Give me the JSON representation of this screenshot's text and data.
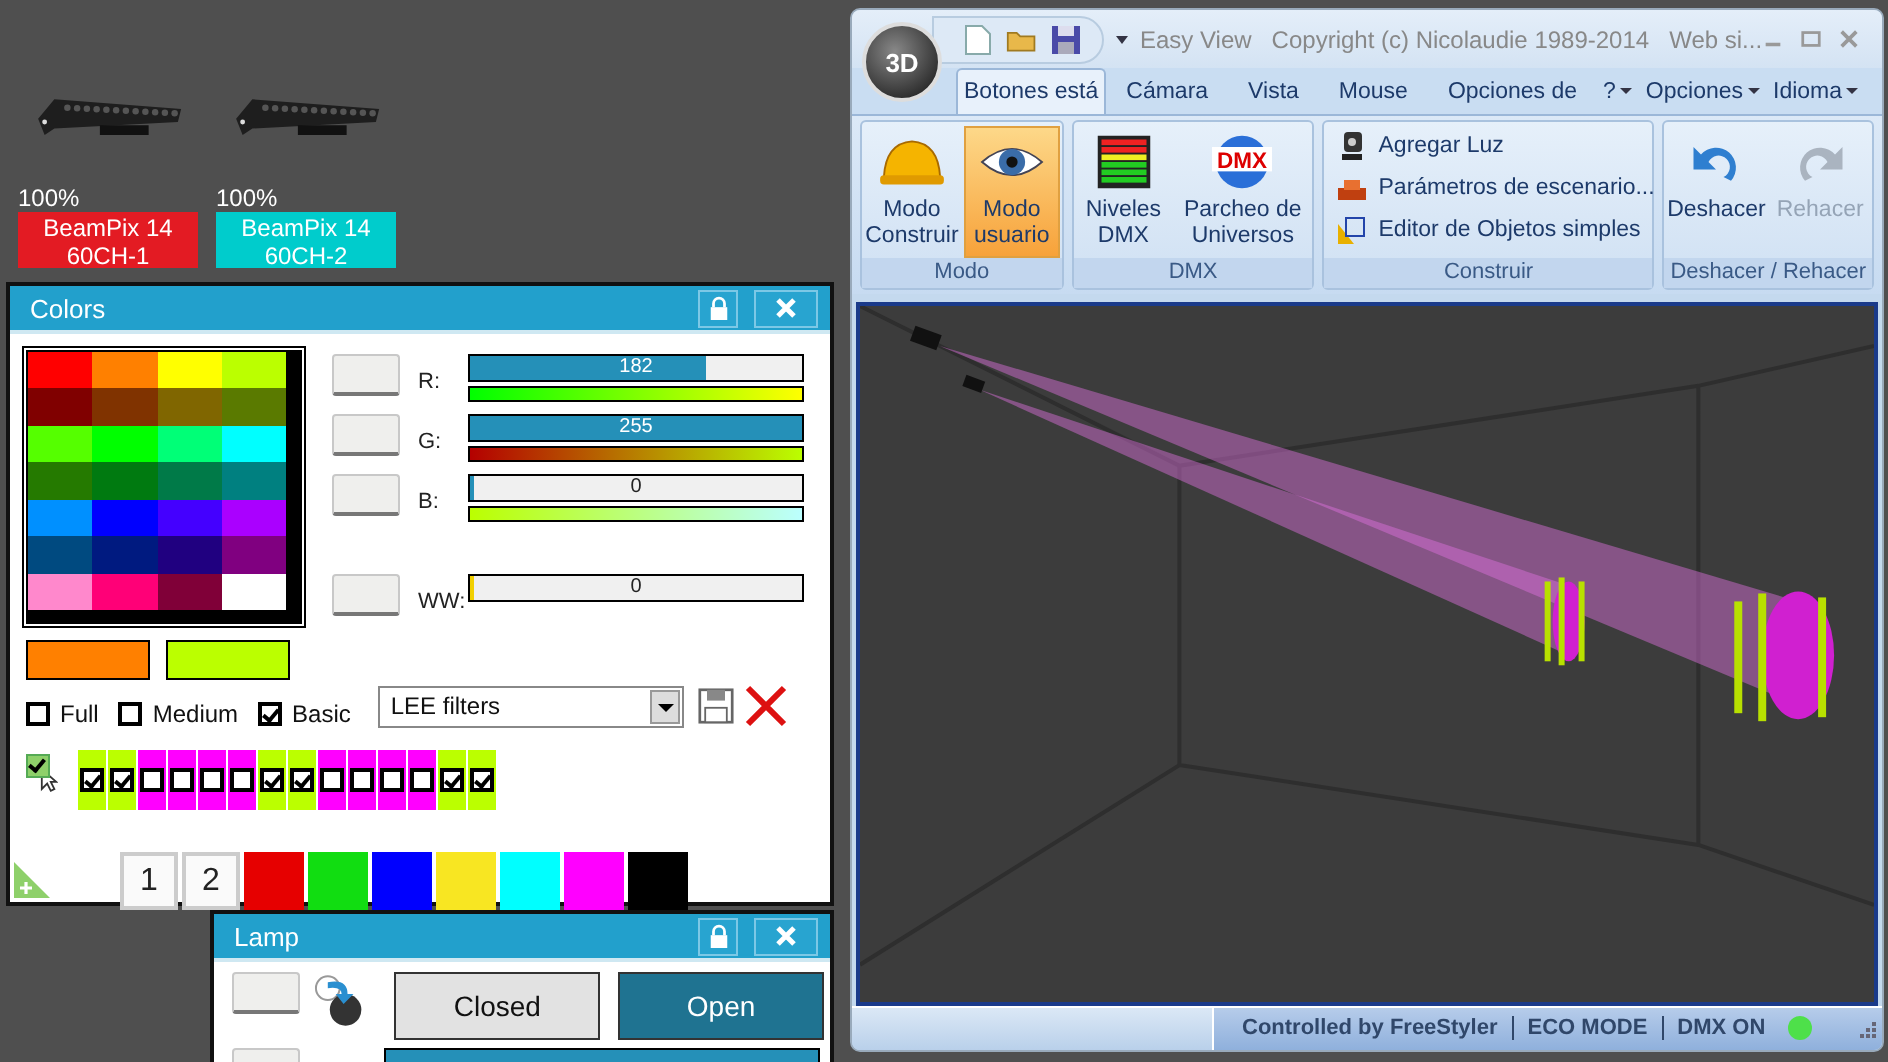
{
  "fixtures": [
    {
      "intensity": "100%",
      "name": "BeamPix 14 60CH-1",
      "color": "#e31b23"
    },
    {
      "intensity": "100%",
      "name": "BeamPix 14 60CH-2",
      "color": "#00cccc"
    }
  ],
  "colors_panel": {
    "title": "Colors",
    "palette": [
      {
        "color": "#ff0000"
      },
      {
        "color": "#ff8000"
      },
      {
        "color": "#ffff00"
      },
      {
        "color": "#bbff00"
      },
      {
        "color": "#800000"
      },
      {
        "color": "#803300"
      },
      {
        "color": "#806600"
      },
      {
        "color": "#5a7a00"
      },
      {
        "color": "#55ff00"
      },
      {
        "color": "#00ff00"
      },
      {
        "color": "#00ff77"
      },
      {
        "color": "#00ffff"
      },
      {
        "color": "#257a00"
      },
      {
        "color": "#007a10"
      },
      {
        "color": "#007a48"
      },
      {
        "color": "#008080"
      },
      {
        "color": "#0090ff"
      },
      {
        "color": "#0000ff"
      },
      {
        "color": "#4400ff"
      },
      {
        "color": "#aa00ff"
      },
      {
        "color": "#004a80"
      },
      {
        "color": "#001a80"
      },
      {
        "color": "#200080"
      },
      {
        "color": "#800080"
      },
      {
        "color": "#ff88cc"
      },
      {
        "color": "#ff0077"
      },
      {
        "color": "#800038"
      },
      {
        "color": "#ffffff"
      }
    ],
    "channels": [
      {
        "label": "R:",
        "reading": "182",
        "level": 0.71,
        "kind": "color"
      },
      {
        "label": "G:",
        "reading": "255",
        "level": 1,
        "kind": "color"
      },
      {
        "label": "B:",
        "reading": "0",
        "level": 0,
        "kind": "color"
      },
      {
        "label": "WW:",
        "reading": "0",
        "level": 0,
        "kind": "white"
      }
    ],
    "current_colors": [
      {
        "color": "#ff8000"
      },
      {
        "color": "#bbff00"
      }
    ],
    "modes": [
      {
        "label": "Full",
        "checked": false
      },
      {
        "label": "Medium",
        "checked": false
      },
      {
        "label": "Basic",
        "checked": true
      }
    ],
    "filter": {
      "value": "LEE filters"
    },
    "select_all": {
      "checked": true
    },
    "pixels": [
      {
        "checked": true
      },
      {
        "checked": true
      },
      {
        "checked": false
      },
      {
        "checked": false
      },
      {
        "checked": false
      },
      {
        "checked": false
      },
      {
        "checked": true
      },
      {
        "checked": true
      },
      {
        "checked": false
      },
      {
        "checked": false
      },
      {
        "checked": false
      },
      {
        "checked": false
      },
      {
        "checked": true
      },
      {
        "checked": true
      }
    ],
    "presets": [
      {
        "kind": "number",
        "label": "1"
      },
      {
        "kind": "number",
        "label": "2"
      },
      {
        "kind": "color",
        "color": "#e60000"
      },
      {
        "kind": "color",
        "color": "#11dd11"
      },
      {
        "kind": "color",
        "color": "#0000ff"
      },
      {
        "kind": "color",
        "color": "#f8e622"
      },
      {
        "kind": "color",
        "color": "#00ffff"
      },
      {
        "kind": "color",
        "color": "#ff00ff"
      },
      {
        "kind": "color",
        "color": "#000000"
      }
    ]
  },
  "lamp_panel": {
    "title": "Lamp",
    "buttons": [
      {
        "label": "Closed",
        "selected": false
      },
      {
        "label": "Open",
        "selected": true
      }
    ],
    "level": 1
  },
  "app_window": {
    "app_button": "3D",
    "title": "Easy View   Copyright (c) Nicolaudie 1989-2014   Web si...",
    "tabs": [
      {
        "label": "Botones está",
        "selected": true
      },
      {
        "label": "Cámara",
        "selected": false
      },
      {
        "label": "Vista",
        "selected": false
      },
      {
        "label": "Mouse",
        "selected": false
      },
      {
        "label": "Opciones de",
        "selected": false
      }
    ],
    "menus": [
      "?",
      "Opciones",
      "Idioma"
    ],
    "groups": [
      {
        "title": "Modo",
        "kind": "large",
        "buttons": [
          {
            "label": "Modo Construir",
            "selected": false,
            "disabled": false
          },
          {
            "label": "Modo usuario",
            "selected": true,
            "disabled": false
          }
        ]
      },
      {
        "title": "DMX",
        "kind": "large",
        "buttons": [
          {
            "label": "Niveles DMX",
            "selected": false,
            "disabled": false
          },
          {
            "label": "Parcheo de Universos",
            "selected": false,
            "disabled": false,
            "badge": "DMX"
          }
        ]
      },
      {
        "title": "Construir",
        "kind": "list",
        "buttons": [
          {
            "label": "Agregar Luz"
          },
          {
            "label": "Parámetros de escenario..."
          },
          {
            "label": "Editor de Objetos simples"
          }
        ]
      },
      {
        "title": "Deshacer / Rehacer",
        "kind": "large",
        "buttons": [
          {
            "label": "Deshacer",
            "selected": false,
            "disabled": false
          },
          {
            "label": "Rehacer",
            "selected": false,
            "disabled": true
          }
        ]
      }
    ],
    "status": {
      "items": [
        "Controlled by FreeStyler",
        "ECO MODE",
        "DMX ON"
      ],
      "led_on": true
    }
  }
}
